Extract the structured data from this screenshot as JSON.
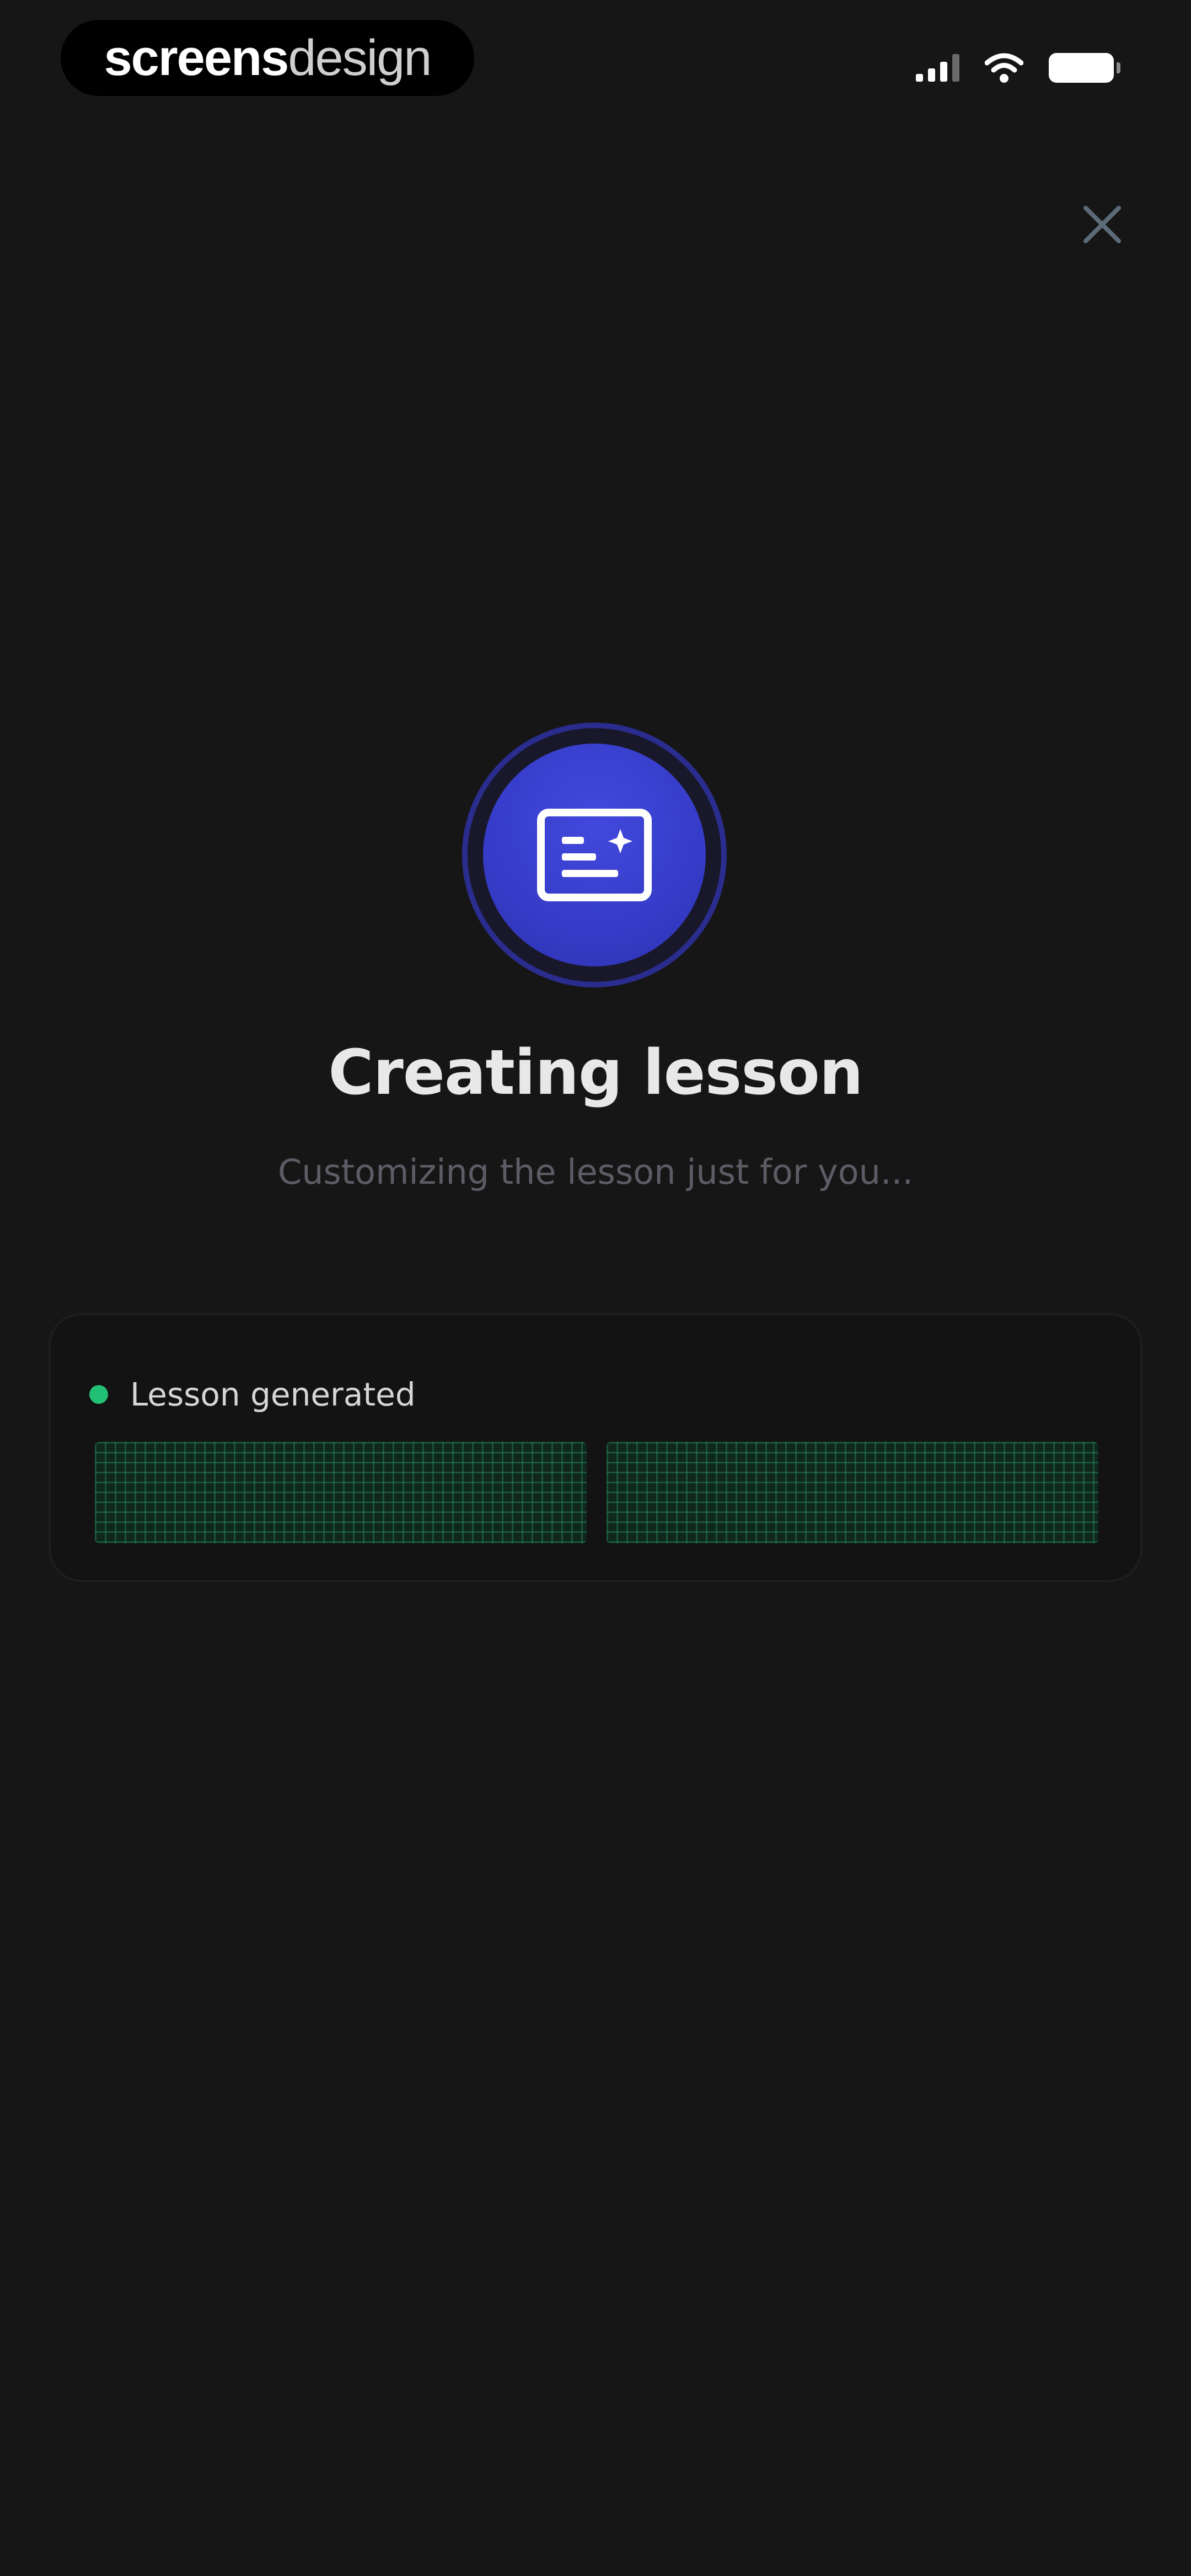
{
  "status_bar": {
    "brand_bold": "screens",
    "brand_light": "design",
    "icons": [
      "signal-icon",
      "wifi-icon",
      "battery-icon"
    ]
  },
  "header": {
    "close_icon": "close-icon"
  },
  "hero": {
    "icon": "lesson-card-icon",
    "accent_color": "#363cc8",
    "title": "Creating lesson",
    "subtitle": "Customizing the lesson just for you..."
  },
  "progress": {
    "status_label": "Lesson generated",
    "status_color": "#22c074",
    "segments_total": 2,
    "segments_complete": 2
  }
}
